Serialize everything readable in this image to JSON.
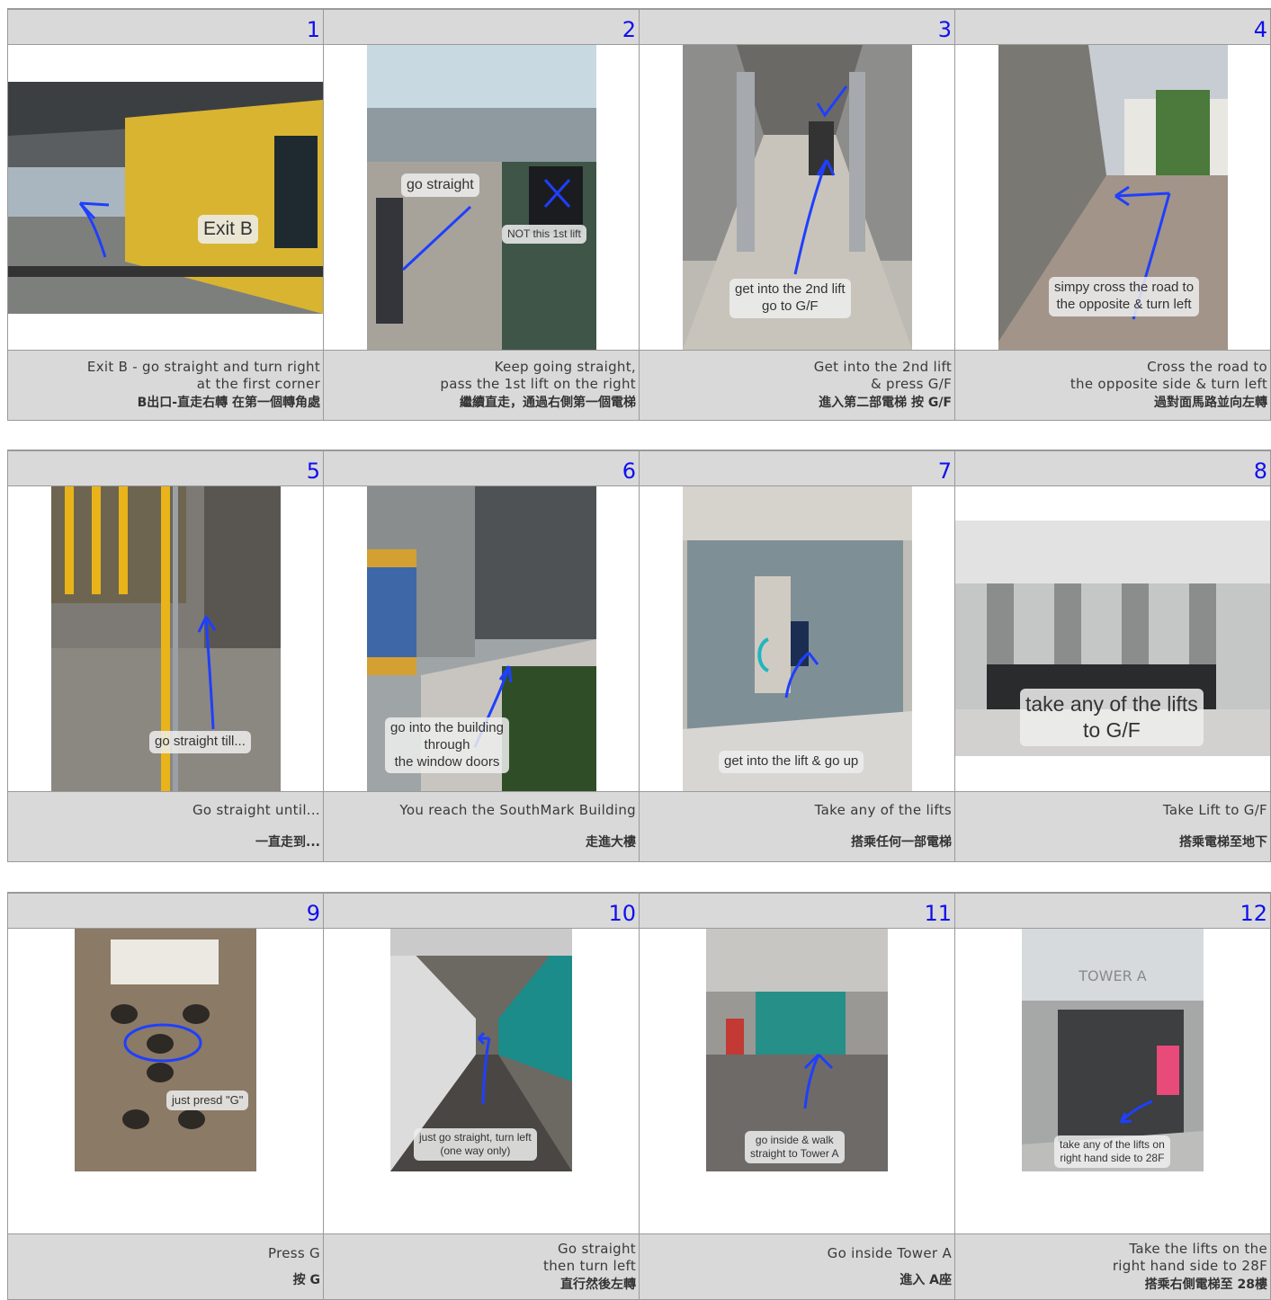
{
  "rows": [
    {
      "steps": [
        {
          "number": "1",
          "labels": [
            "Exit B"
          ],
          "caption_en": "Exit B - go straight and turn right\nat the first corner",
          "caption_zh": "B出口-直走右轉 在第一個轉角處"
        },
        {
          "number": "2",
          "labels": [
            "go straight",
            "NOT this 1st lift"
          ],
          "caption_en": "Keep going straight,\npass the 1st lift on the right",
          "caption_zh": "繼續直走，通過右側第一個電梯"
        },
        {
          "number": "3",
          "labels": [
            "get into the 2nd lift\ngo to G/F"
          ],
          "caption_en": "Get into the 2nd lift\n& press G/F",
          "caption_zh": "進入第二部電梯 按 G/F"
        },
        {
          "number": "4",
          "labels": [
            "simpy cross the road to\nthe opposite & turn left"
          ],
          "caption_en": "Cross the road to\nthe opposite side & turn left",
          "caption_zh": "過對面馬路並向左轉"
        }
      ]
    },
    {
      "steps": [
        {
          "number": "5",
          "labels": [
            "go straight till..."
          ],
          "caption_en": "Go straight until...",
          "caption_zh": "一直走到..."
        },
        {
          "number": "6",
          "labels": [
            "go into the building\nthrough\nthe window doors"
          ],
          "caption_en": "You reach the SouthMark Building",
          "caption_zh": "走進大樓"
        },
        {
          "number": "7",
          "labels": [
            "get into the lift & go up"
          ],
          "caption_en": "Take any of the lifts",
          "caption_zh": "搭乘任何一部電梯"
        },
        {
          "number": "8",
          "labels": [
            "take any of the lifts\nto G/F"
          ],
          "caption_en": "Take Lift to G/F",
          "caption_zh": "搭乘電梯至地下"
        }
      ]
    },
    {
      "steps": [
        {
          "number": "9",
          "labels": [
            "just presd \"G\""
          ],
          "caption_en": "Press G",
          "caption_zh": "按 G"
        },
        {
          "number": "10",
          "labels": [
            "just go straight, turn left\n(one way only)"
          ],
          "caption_en": "Go straight\nthen turn left",
          "caption_zh": "直行然後左轉"
        },
        {
          "number": "11",
          "labels": [
            "go inside & walk\nstraight to Tower A"
          ],
          "caption_en": "Go inside Tower A",
          "caption_zh": "進入 A座"
        },
        {
          "number": "12",
          "labels": [
            "take any of the lifts on\nright hand side to 28F"
          ],
          "caption_en": "Take the lifts on the\nright hand side to 28F",
          "caption_zh": "搭乘右側電梯至 28樓"
        }
      ]
    }
  ],
  "colors": {
    "header_bg": "#d9d9d9",
    "step_number": "#1010ee",
    "arrow": "#1f3fff",
    "border": "#9a9a9a"
  }
}
